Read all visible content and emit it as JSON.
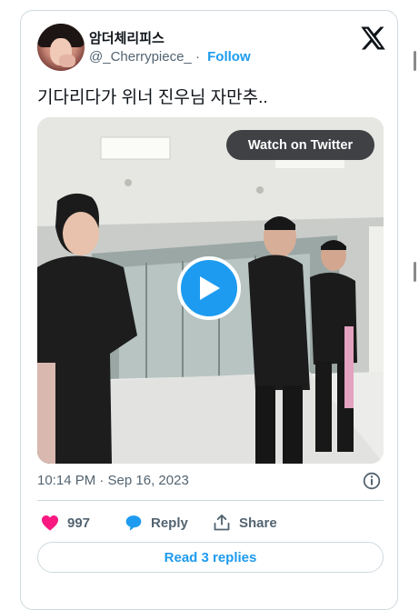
{
  "author": {
    "display_name": "암더체리피스",
    "handle": "@_Cherrypiece_",
    "separator": "·",
    "follow_label": "Follow"
  },
  "tweet": {
    "text": "기다리다가 위너 진우님 자만추..",
    "timestamp": "10:14 PM · Sep 16, 2023"
  },
  "media": {
    "watch_label": "Watch on Twitter"
  },
  "actions": {
    "like_count": "997",
    "reply_label": "Reply",
    "share_label": "Share"
  },
  "read_replies_label": "Read 3 replies",
  "colors": {
    "accent": "#1d9bf0",
    "like": "#f91880",
    "muted": "#536471"
  }
}
